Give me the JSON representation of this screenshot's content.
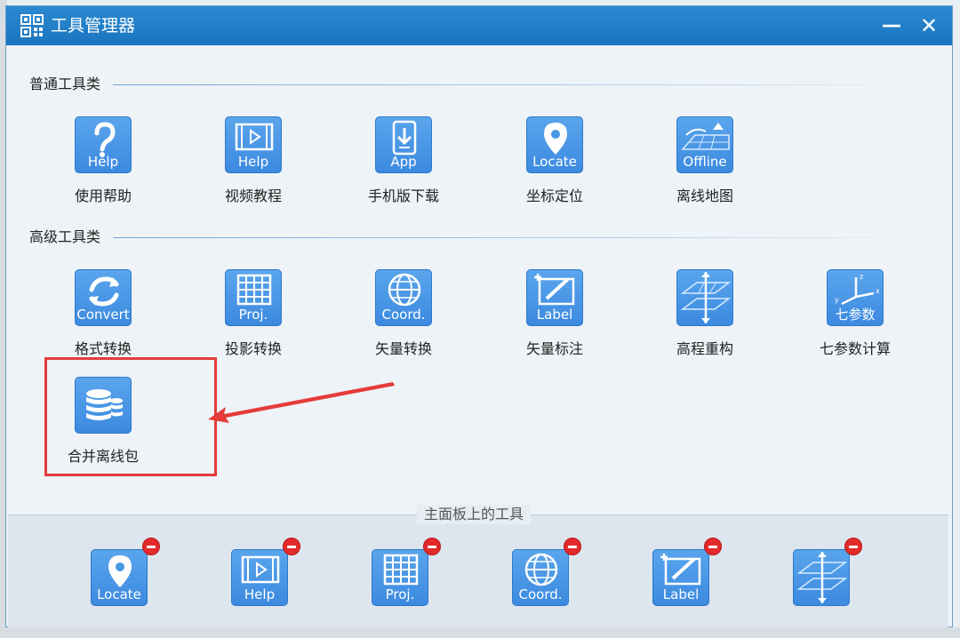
{
  "window": {
    "title": "工具管理器",
    "minimize": "—",
    "close": "✕"
  },
  "sections": {
    "common": "普通工具类",
    "advanced": "高级工具类"
  },
  "common_tools": [
    {
      "label": "使用帮助",
      "caption": "Help",
      "icon": "question-icon"
    },
    {
      "label": "视频教程",
      "caption": "Help",
      "icon": "video-icon"
    },
    {
      "label": "手机版下载",
      "caption": "App",
      "icon": "phone-download-icon"
    },
    {
      "label": "坐标定位",
      "caption": "Locate",
      "icon": "location-pin-icon"
    },
    {
      "label": "离线地图",
      "caption": "Offline",
      "icon": "offline-map-icon"
    }
  ],
  "advanced_tools": [
    {
      "label": "格式转换",
      "caption": "Convert",
      "icon": "convert-icon"
    },
    {
      "label": "投影转换",
      "caption": "Proj.",
      "icon": "grid-icon"
    },
    {
      "label": "矢量转换",
      "caption": "Coord.",
      "icon": "globe-icon"
    },
    {
      "label": "矢量标注",
      "caption": "Label",
      "icon": "label-icon"
    },
    {
      "label": "高程重构",
      "caption": "",
      "icon": "elevation-icon"
    },
    {
      "label": "七参数计算",
      "caption": "七参数",
      "icon": "axes-icon"
    },
    {
      "label": "合并离线包",
      "caption": "",
      "icon": "database-icon"
    }
  ],
  "panel": {
    "title": "主面板上的工具",
    "tools": [
      {
        "caption": "Locate",
        "icon": "location-pin-icon"
      },
      {
        "caption": "Help",
        "icon": "video-icon"
      },
      {
        "caption": "Proj.",
        "icon": "grid-icon"
      },
      {
        "caption": "Coord.",
        "icon": "globe-icon"
      },
      {
        "caption": "Label",
        "icon": "label-icon"
      },
      {
        "caption": "",
        "icon": "elevation-icon"
      }
    ]
  },
  "colors": {
    "titlebar": "#1f7cc5",
    "tile": "#4a98e6",
    "highlight": "#e53b3b",
    "remove_badge": "#e32a2a"
  }
}
